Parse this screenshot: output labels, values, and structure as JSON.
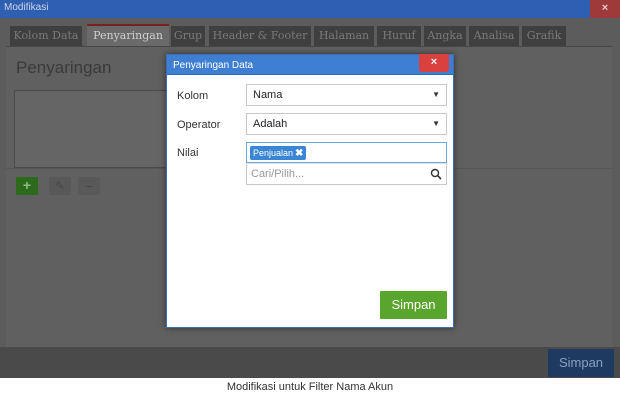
{
  "window": {
    "title": "Modifikasi",
    "close_label": "×"
  },
  "tabs": [
    {
      "label": "Kolom Data"
    },
    {
      "label": "Penyaringan"
    },
    {
      "label": "Grup"
    },
    {
      "label": "Header & Footer"
    },
    {
      "label": "Halaman"
    },
    {
      "label": "Huruf"
    },
    {
      "label": "Angka"
    },
    {
      "label": "Analisa"
    },
    {
      "label": "Grafik"
    }
  ],
  "background": {
    "heading": "Penyaringan",
    "add_icon": "plus-icon",
    "edit_icon": "pencil-icon",
    "delete_icon": "minus-icon",
    "save_label": "Simpan"
  },
  "modal": {
    "title": "Penyaringan Data",
    "close_label": "×",
    "kolom": {
      "label": "Kolom",
      "value": "Nama"
    },
    "operator": {
      "label": "Operator",
      "value": "Adalah"
    },
    "nilai": {
      "label": "Nilai",
      "tags": [
        "Penjualan"
      ],
      "search_placeholder": "Cari/Pilih..."
    },
    "save_label": "Simpan"
  },
  "caption": "Modifikasi untuk Filter Nama Akun",
  "colors": {
    "titlebar": "#2f5fb1",
    "modal_titlebar": "#3f7fd3",
    "close": "#d9413e",
    "save_green": "#5aa52e",
    "tag_blue": "#3a86d4"
  }
}
